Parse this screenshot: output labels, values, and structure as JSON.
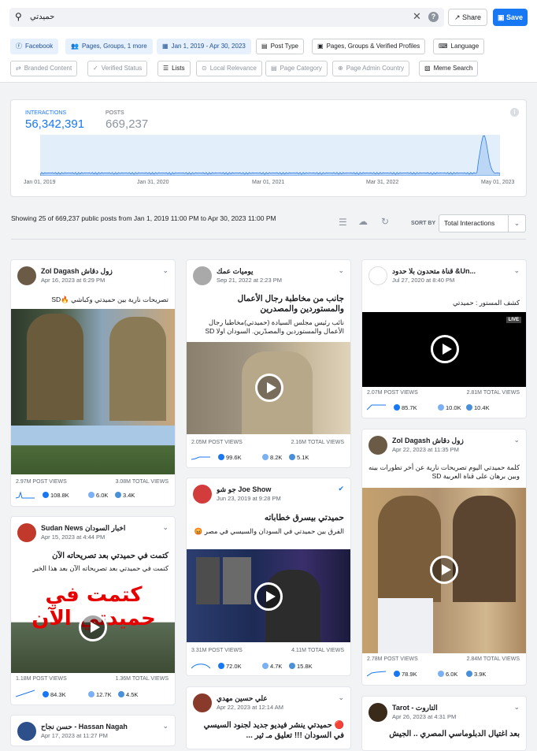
{
  "search": {
    "query": "حميدتي"
  },
  "header": {
    "share_label": "Share",
    "save_label": "Save"
  },
  "filters": {
    "facebook": "Facebook",
    "pages_groups": "Pages, Groups, 1 more",
    "date_range": "Jan 1, 2019 - Apr 30, 2023",
    "post_type": "Post Type",
    "profiles": "Pages, Groups & Verified Profiles",
    "language": "Language",
    "branded": "Branded Content",
    "verified": "Verified Status",
    "lists": "Lists",
    "local": "Local Relevance",
    "category": "Page Category",
    "admin_country": "Page Admin Country",
    "meme": "Meme Search"
  },
  "stats": {
    "interactions_label": "INTERACTIONS",
    "interactions_value": "56,342,391",
    "posts_label": "POSTS",
    "posts_value": "669,237",
    "ticks": [
      "Jan 01, 2019",
      "Jan 31, 2020",
      "Mar 01, 2021",
      "Mar 31, 2022",
      "May 01, 2023"
    ]
  },
  "chart_data": {
    "type": "area",
    "title": "",
    "xlabel": "",
    "ylabel": "",
    "x": [
      "Jan 01, 2019",
      "Jan 31, 2020",
      "Mar 01, 2021",
      "Mar 31, 2022",
      "Apr 16, 2023",
      "May 01, 2023"
    ],
    "values": [
      2,
      2,
      2,
      3,
      40,
      6
    ],
    "grid": false
  },
  "results": {
    "showing_text": "Showing 25 of 669,237 public posts from Jan 1, 2019 11:00 PM to Apr 30, 2023 11:00 PM",
    "sort_label": "SORT BY",
    "sort_value": "Total Interactions"
  },
  "cards": [
    {
      "account": "Zol Dagash زول دقاش",
      "date": "Apr 16, 2023 at 6:29 PM",
      "text": "تصريحات نارية بين حميدتي وكباشي 🔥SD",
      "post_views": "2.97M POST VIEWS",
      "total_views": "3.08M TOTAL VIEWS",
      "r1": "108.8K",
      "r2": "6.0K",
      "r3": "3.4K"
    },
    {
      "account": "Sudan News اخبار السودان",
      "date": "Apr 15, 2023 at 4:44 PM",
      "title": "كتمت في حميدتي بعد تصريحاته الآن",
      "text": "كتمت في حميدتي بعد تصريحاته الآن بعد هذا الخبر",
      "overlay": "كتمت في حميدتي الآن",
      "post_views": "1.18M POST VIEWS",
      "total_views": "1.36M TOTAL VIEWS",
      "r1": "84.3K",
      "r2": "12.7K",
      "r3": "4.5K"
    },
    {
      "account": "حسن نجاح - Hassan Nagah",
      "date": "Apr 17, 2023 at 11:27 PM"
    },
    {
      "account": "يوميات عمك",
      "date": "Sep 21, 2022 at 2:23 PM",
      "title": "جانب من مخاطبة رجال الأعمال والمستوردين والمصدرين",
      "text": "نائب رئيس مجلس السيادة (حميدتي)مخاطبا رجال الأعمال والمستوردين والمصدّرين. السودان اولا SD",
      "post_views": "2.05M POST VIEWS",
      "total_views": "2.16M TOTAL VIEWS",
      "r1": "99.6K",
      "r2": "8.2K",
      "r3": "5.1K"
    },
    {
      "account": "جو شو Joe Show",
      "date": "Jun 23, 2019 at 9:28 PM",
      "title": "حميدتي بيسرق خطاباته",
      "text": "الفرق بين حميدتي في السودان والسيسي في مصر 😡",
      "post_views": "3.31M POST VIEWS",
      "total_views": "4.11M TOTAL VIEWS",
      "r1": "72.0K",
      "r2": "4.7K",
      "r3": "15.8K"
    },
    {
      "account": "علي حسين مهدي",
      "date": "Apr 22, 2023 at 12:14 AM",
      "title": "🔴 حميدتي ينشر فيديو جديد لجنود السيسي في السودان !!! تعليق مـ ثير ..."
    },
    {
      "account": "قناة متحدون بلا حدود &Un...",
      "date": "Jul 27, 2020 at 8:40 PM",
      "text": "كشف المستور : حميدتي",
      "live": "LIVE",
      "post_views": "2.07M POST VIEWS",
      "total_views": "2.81M TOTAL VIEWS",
      "r1": "85.7K",
      "r2": "10.0K",
      "r3": "10.4K"
    },
    {
      "account": "Zol Dagash زول دقاش",
      "date": "Apr 22, 2023 at 11:35 PM",
      "text": "كلمة حميدتي اليوم تصريحات نارية عن أخر تطورات بينه وبين برهان على قناة العربية SD",
      "post_views": "2.78M POST VIEWS",
      "total_views": "2.84M TOTAL VIEWS",
      "r1": "78.9K",
      "r2": "6.0K",
      "r3": "3.9K"
    },
    {
      "account": "Tarot - التاروت",
      "date": "Apr 26, 2023 at 4:31 PM",
      "title": "بعد اغتيال الدبلوماسي المصري .. الجيش"
    }
  ]
}
